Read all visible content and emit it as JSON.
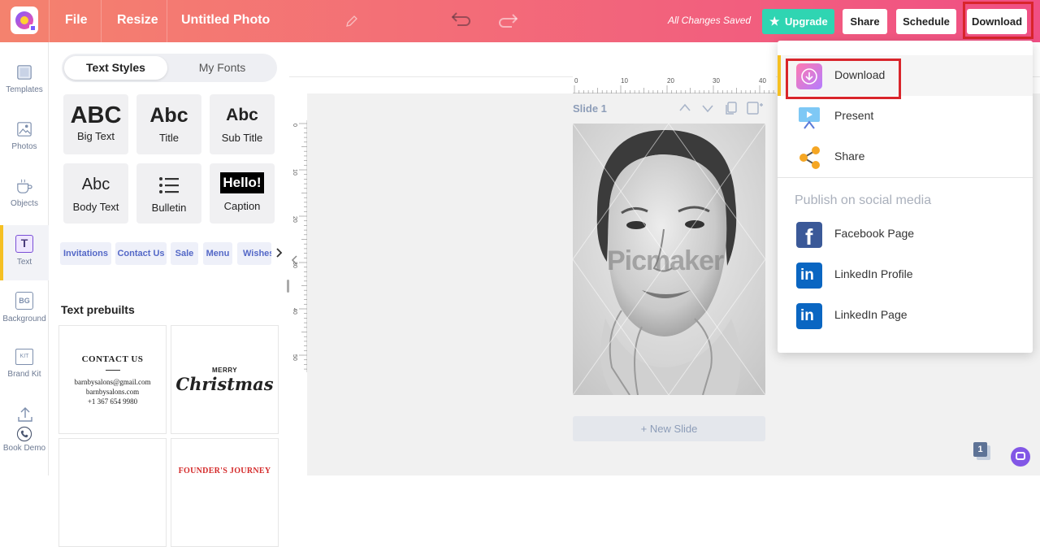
{
  "topbar": {
    "file": "File",
    "resize": "Resize",
    "doc_title": "Untitled Photo",
    "saved_status": "All Changes Saved",
    "upgrade": "Upgrade",
    "share": "Share",
    "schedule": "Schedule",
    "download": "Download"
  },
  "rail": {
    "templates": "Templates",
    "photos": "Photos",
    "objects": "Objects",
    "text": "Text",
    "text_icon": "T",
    "background": "Background",
    "background_icon": "BG",
    "brandkit": "Brand Kit",
    "brandkit_icon": "KIT",
    "bookdemo": "Book Demo"
  },
  "panel": {
    "tab_text_styles": "Text Styles",
    "tab_my_fonts": "My Fonts",
    "styles": [
      {
        "sample": "ABC",
        "label": "Big Text"
      },
      {
        "sample": "Abc",
        "label": "Title"
      },
      {
        "sample": "Abc",
        "label": "Sub Title"
      },
      {
        "sample": "Abc",
        "label": "Body Text"
      },
      {
        "sample": "",
        "label": "Bulletin"
      },
      {
        "sample": "Hello!",
        "label": "Caption"
      }
    ],
    "chips": [
      "Invitations",
      "Contact Us",
      "Sale",
      "Menu",
      "Wishes"
    ],
    "prebuilts_title": "Text prebuilts",
    "prebuilt_contact": {
      "heading": "CONTACT US",
      "email": "barnbysalons@gmail.com",
      "site": "barnbysalons.com",
      "phone": "+1 367 654 9980"
    },
    "prebuilt_christmas": {
      "small": "MERRY",
      "script": "Christmas"
    },
    "prebuilt_founder": "FOUNDER'S JOURNEY"
  },
  "canvas": {
    "ruler_top": [
      "0",
      "10",
      "20",
      "30",
      "40"
    ],
    "ruler_left": [
      "0",
      "10",
      "20",
      "30",
      "40",
      "50"
    ],
    "slide_label": "Slide 1",
    "watermark": "Picmaker",
    "new_slide": "+ New Slide",
    "page_count": "1"
  },
  "download_menu": {
    "items": [
      {
        "label": "Download",
        "icon": "download-icon"
      },
      {
        "label": "Present",
        "icon": "present-icon"
      },
      {
        "label": "Share",
        "icon": "share-icon"
      }
    ],
    "publish_heading": "Publish on social media",
    "social": [
      {
        "label": "Facebook Page",
        "icon": "facebook-icon"
      },
      {
        "label": "LinkedIn Profile",
        "icon": "linkedin-icon"
      },
      {
        "label": "LinkedIn Page",
        "icon": "linkedin-icon"
      }
    ]
  },
  "colors": {
    "accent_yellow": "#f5c023",
    "upgrade_green": "#2fd5b2",
    "highlight_red": "#d9252b",
    "facebook_blue": "#3b5998",
    "linkedin_blue": "#0a66c2"
  }
}
